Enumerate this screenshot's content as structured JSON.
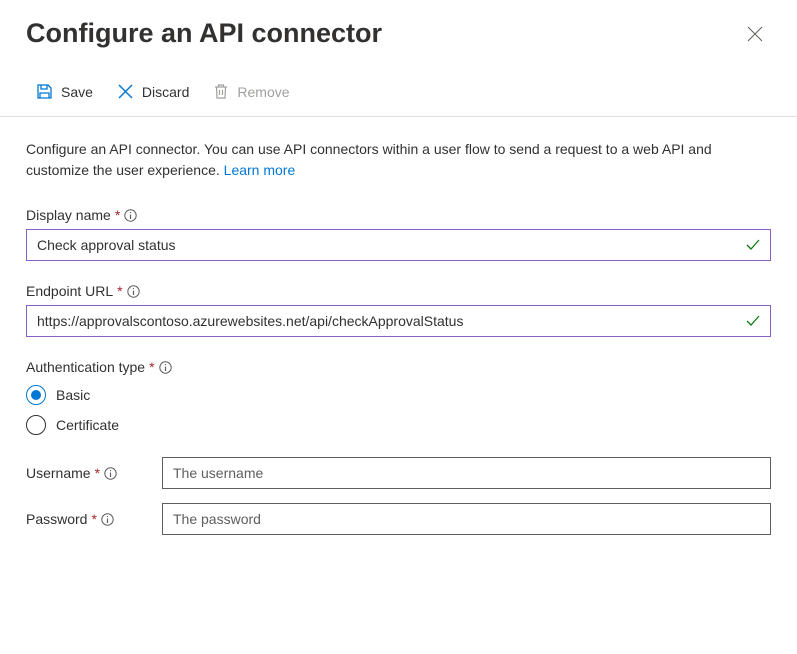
{
  "header": {
    "title": "Configure an API connector"
  },
  "toolbar": {
    "save_label": "Save",
    "discard_label": "Discard",
    "remove_label": "Remove"
  },
  "description": {
    "text": "Configure an API connector. You can use API connectors within a user flow to send a request to a web API and customize the user experience. ",
    "link_text": "Learn more"
  },
  "form": {
    "display_name": {
      "label": "Display name",
      "value": "Check approval status"
    },
    "endpoint_url": {
      "label": "Endpoint URL",
      "value": "https://approvalscontoso.azurewebsites.net/api/checkApprovalStatus"
    },
    "auth_type": {
      "label": "Authentication type",
      "options": {
        "basic": "Basic",
        "certificate": "Certificate"
      },
      "selected": "basic"
    },
    "username": {
      "label": "Username",
      "placeholder": "The username",
      "value": ""
    },
    "password": {
      "label": "Password",
      "placeholder": "The password",
      "value": ""
    }
  }
}
